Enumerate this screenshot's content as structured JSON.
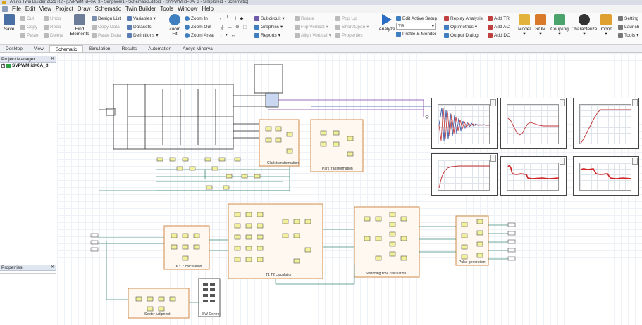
{
  "window": {
    "title": "Ansys Twin Builder 2021 R2 - [SVPWM id=0A_3 - Simplorer1 - SchematicEditor1 - [SVPWM id=0A_3 - Simplorer1 - Schematic]"
  },
  "menu": [
    "File",
    "Edit",
    "View",
    "Project",
    "Draw",
    "Schematic",
    "Twin Builder",
    "Tools",
    "Window",
    "Help"
  ],
  "ribbon": {
    "save": "Save",
    "cut": "Cut",
    "copy": "Copy",
    "paste": "Paste",
    "undo": "Undo",
    "redo": "Redo",
    "delete": "Delete",
    "find_elements": "Find Elements",
    "design_list": "Design List",
    "copy_data": "Copy Data",
    "paste_data": "Paste Data",
    "variables": "Variables",
    "datasets": "Datasets",
    "definitions": "Definitions",
    "zoom_fit": "Zoom Fit",
    "zoom_in": "Zoom In",
    "zoom_out": "Zoom Out",
    "zoom_area": "Zoom Area",
    "subcircuit": "Subcircuit",
    "graphics": "Graphics",
    "reports": "Reports",
    "rotate": "Rotate",
    "flip_vertical": "Flip Vertical",
    "align_vertical": "Align Vertical",
    "pop_up": "Pop Up",
    "short_open": "Short/Open",
    "properties": "Properties",
    "analyze": "Analyze",
    "analysis_value": "TR",
    "edit_active_setup": "Edit Active Setup",
    "profile_monitor": "Profile & Monitor",
    "replay_analysis": "Replay Analysis",
    "optimetrics": "Optimetrics",
    "output_dialog": "Output Dialog",
    "add_tr": "Add TR",
    "add_ac": "Add AC",
    "add_dc": "Add DC",
    "model": "Model",
    "rom": "ROM",
    "coupling": "Coupling",
    "characterize": "Characterize",
    "import": "Import",
    "settings": "Setting",
    "launch": "Launch",
    "tools": "Tools"
  },
  "tabs": [
    "Desktop",
    "View",
    "Schematic",
    "Simulation",
    "Results",
    "Automation",
    "Ansys Minerva"
  ],
  "active_tab": "Schematic",
  "project_manager": {
    "title": "Project Manager",
    "item": "SVPWM id=0A_3"
  },
  "properties": {
    "title": "Properties"
  },
  "blocks": {
    "clark": "Clark transformation",
    "park": "Park transformation",
    "xyz": "X Y Z calculation",
    "t1t2": "T1 T2 calculation",
    "switching": "Switching time calculation",
    "pulse": "Pulse generation",
    "sector": "Sector judgment",
    "sw_control": "SW Control"
  },
  "colors": {
    "accent": "#2b6cc4",
    "block_border": "#d08a4a",
    "wire": "#3c8a7a",
    "ribbon_bg": "#fafafa"
  }
}
